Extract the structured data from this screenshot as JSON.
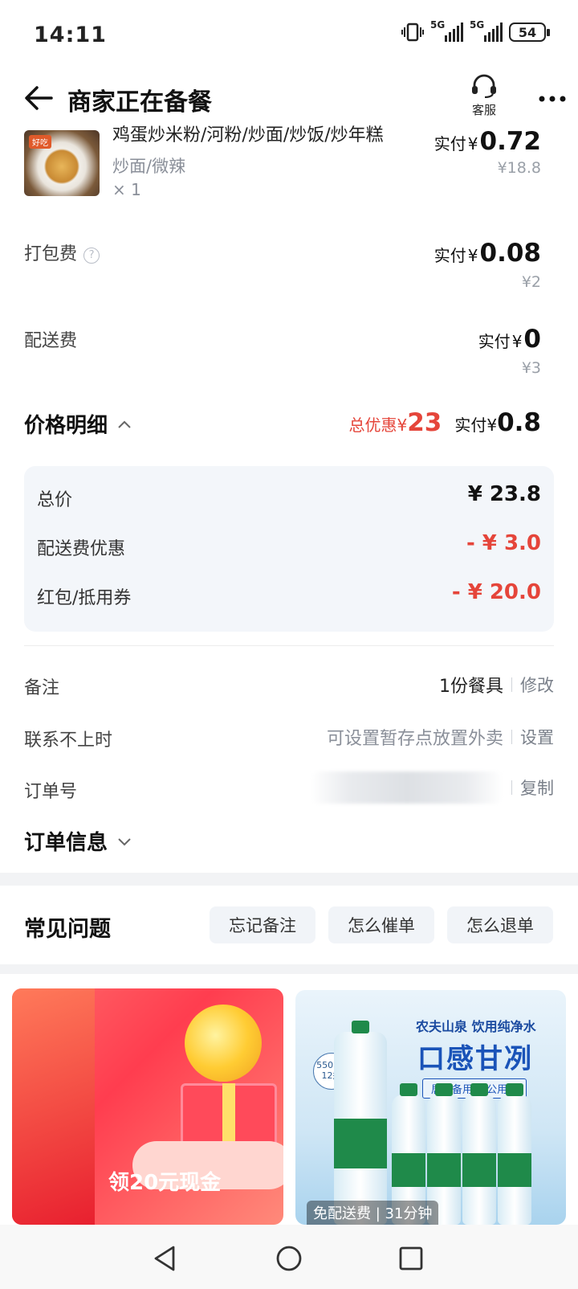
{
  "status_bar": {
    "time": "14:11",
    "net1": "5G",
    "net2": "5G",
    "battery": "54"
  },
  "header": {
    "title": "商家正在备餐",
    "service_label": "客服"
  },
  "item": {
    "name": "鸡蛋炒米粉/河粉/炒面/炒饭/炒年糕",
    "spec": "炒面/微辣",
    "qty": "× 1",
    "pay_prefix": "实付",
    "pay_yen": "¥",
    "pay_amount": "0.72",
    "original": "¥18.8"
  },
  "packing": {
    "label": "打包费",
    "help": "?",
    "pay_prefix": "实付",
    "pay_yen": "¥",
    "pay_amount": "0.08",
    "original": "¥2"
  },
  "delivery": {
    "label": "配送费",
    "pay_prefix": "实付",
    "pay_yen": "¥",
    "pay_amount": "0",
    "original": "¥3"
  },
  "price_detail": {
    "title": "价格明细",
    "discount_label": "总优惠",
    "discount_yen": "¥",
    "discount_amount": "23",
    "pay_label": "实付",
    "pay_yen": "¥",
    "pay_amount": "0.8",
    "rows": [
      {
        "label": "总价",
        "value": "¥ 23.8"
      },
      {
        "label": "配送费优惠",
        "value": "- ¥ 3.0"
      },
      {
        "label": "红包/抵用券",
        "value": "- ¥ 20.0"
      }
    ]
  },
  "info": {
    "remark": {
      "label": "备注",
      "value": "1份餐具",
      "action": "修改"
    },
    "contact": {
      "label": "联系不上时",
      "value": "可设置暂存点放置外卖",
      "action": "设置"
    },
    "order_no": {
      "label": "订单号",
      "action": "复制"
    }
  },
  "order_info": {
    "title": "订单信息"
  },
  "faq": {
    "title": "常见问题",
    "chips": [
      "忘记备注",
      "怎么催单",
      "怎么退单"
    ]
  },
  "ads": {
    "left": {
      "text": "领20元现金"
    },
    "right": {
      "brand": "农夫山泉 饮用纯净水",
      "slogan": "口感甘冽",
      "tagline": "居家备用 办公用水",
      "volume": "550mL",
      "count": "12瓶",
      "bottom": "免配送费 | 31分钟"
    }
  },
  "colors": {
    "accent_red": "#e5453a",
    "chip_bg": "#f1f4f8",
    "detail_bg": "#f3f6fa"
  }
}
